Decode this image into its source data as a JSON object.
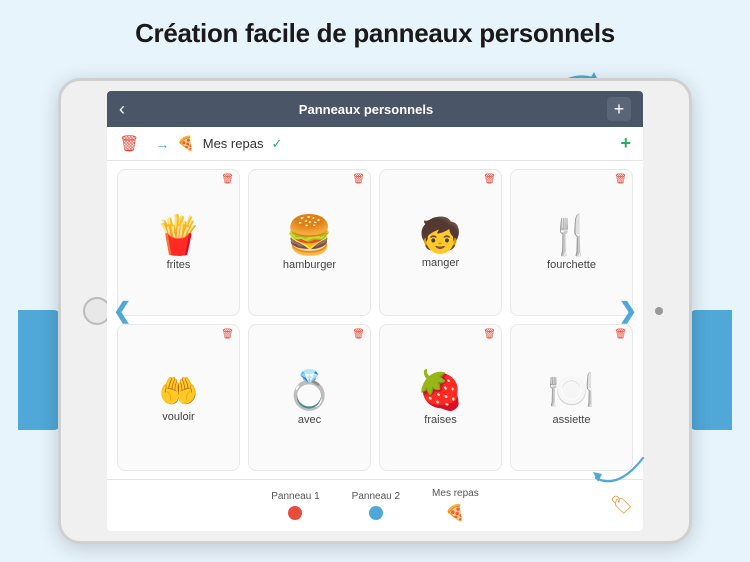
{
  "page": {
    "title": "Création facile de panneaux personnels"
  },
  "navbar": {
    "back_label": "‹",
    "title": "Panneaux personnels",
    "plus_label": "+"
  },
  "editbar": {
    "panel_name": "Mes repas",
    "green_plus": "+"
  },
  "grid": {
    "items": [
      {
        "id": "frites",
        "label": "frites",
        "emoji": "🍟"
      },
      {
        "id": "hamburger",
        "label": "hamburger",
        "emoji": "🍔"
      },
      {
        "id": "manger",
        "label": "manger",
        "emoji": "🧒"
      },
      {
        "id": "fourchette",
        "label": "fourchette",
        "emoji": "🍴"
      },
      {
        "id": "vouloir",
        "label": "vouloir",
        "emoji": "🤲"
      },
      {
        "id": "avec",
        "label": "avec",
        "emoji": "💍"
      },
      {
        "id": "fraises",
        "label": "fraises",
        "emoji": "🍓"
      },
      {
        "id": "assiette",
        "label": "assiette",
        "emoji": "🍽️"
      }
    ]
  },
  "tabs": {
    "items": [
      {
        "label": "Panneau 1",
        "type": "dot",
        "color": "red"
      },
      {
        "label": "Panneau 2",
        "type": "dot",
        "color": "blue"
      },
      {
        "label": "Mes repas",
        "type": "pizza"
      }
    ]
  },
  "icons": {
    "trash": "🗑",
    "back": "‹",
    "plus": "+",
    "check": "✓",
    "arrow_right": "→",
    "tag": "🏷",
    "nav_left": "❮",
    "nav_right": "❯"
  }
}
